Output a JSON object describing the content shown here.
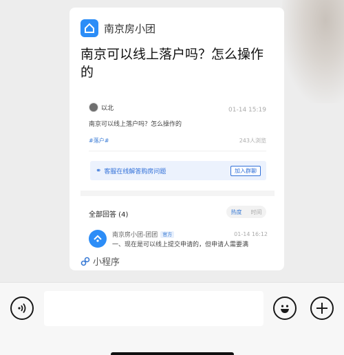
{
  "card": {
    "app_name": "南京房小团",
    "title": "南京可以线上落户吗？怎么操作的",
    "post": {
      "author": "以北",
      "time": "01-14 15:19",
      "text": "南京可以线上落户吗？怎么操作的",
      "tag": "#落户#",
      "views": "243人浏览"
    },
    "service": {
      "text": "客服在线解答购房问题",
      "button": "加入群聊"
    },
    "answers": {
      "title": "全部回答 (4)",
      "sort_hot": "热度",
      "sort_time": "时间",
      "first": {
        "name": "南京房小团-团团",
        "badge": "官方",
        "time": "01-14 16:12",
        "text": "一、现在是可以线上提交申请的，但申请人需要满"
      }
    },
    "mini_program_label": "小程序"
  },
  "bottom_bar": {
    "voice_icon": "voice-icon",
    "emoji_icon": "emoji-icon",
    "plus_icon": "plus-icon",
    "input_value": ""
  },
  "colors": {
    "accent": "#2c8df7",
    "link": "#2f6fd8"
  }
}
